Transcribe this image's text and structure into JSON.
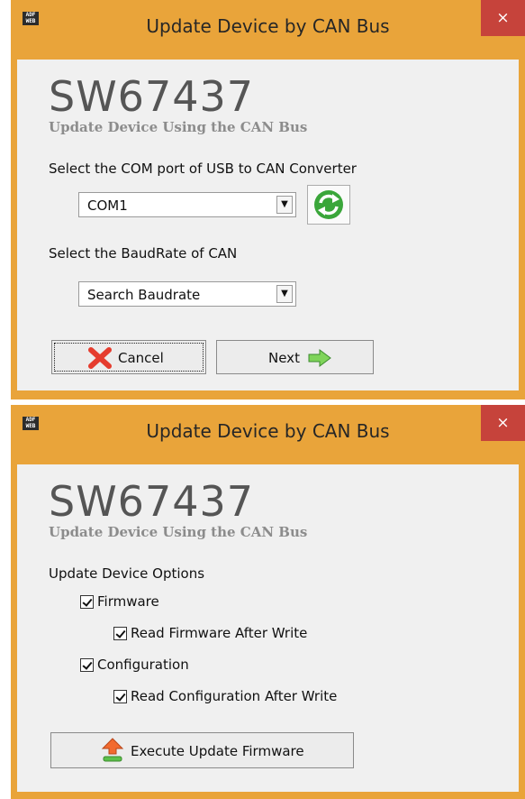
{
  "window1": {
    "title": "Update Device by CAN Bus",
    "app_icon_text": "ADF WEB",
    "close_glyph": "×",
    "brand": "SW67437",
    "subtitle": "Update Device Using the CAN Bus",
    "com_label": "Select the COM port of USB to CAN Converter",
    "com_value": "COM1",
    "baud_label": "Select the BaudRate of CAN",
    "baud_value": "Search Baudrate",
    "cancel_label": "Cancel",
    "next_label": "Next"
  },
  "window2": {
    "title": "Update Device by CAN Bus",
    "app_icon_text": "ADF WEB",
    "close_glyph": "×",
    "brand": "SW67437",
    "subtitle": "Update Device Using the CAN Bus",
    "options_label": "Update Device Options",
    "options": [
      {
        "label": "Firmware",
        "checked": true
      },
      {
        "label": "Read Firmware After Write",
        "checked": true
      },
      {
        "label": "Configuration",
        "checked": true
      },
      {
        "label": "Read Configuration After Write",
        "checked": true
      }
    ],
    "execute_label": "Execute Update Firmware"
  },
  "colors": {
    "frame": "#e9a43a",
    "close": "#c6433b",
    "client": "#f0f0f0",
    "brand": "#555555",
    "subtitle": "#8c8c8c"
  }
}
